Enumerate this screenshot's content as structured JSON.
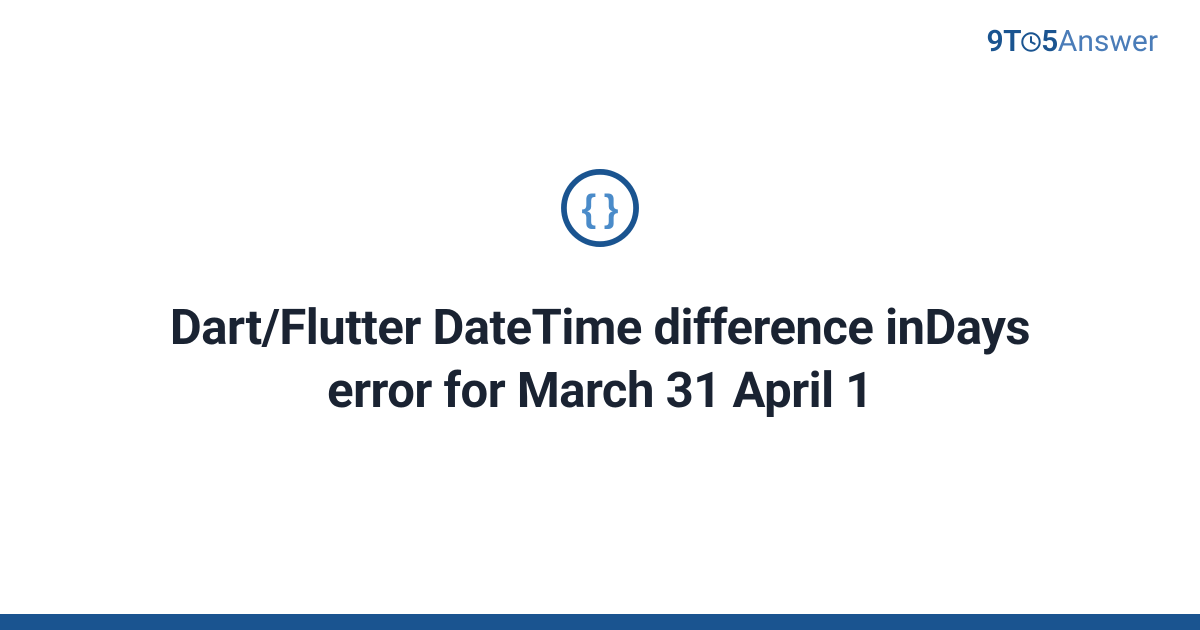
{
  "brand": {
    "logo_nine": "9",
    "logo_t": "T",
    "logo_five": "5",
    "logo_answer": "Answer"
  },
  "main": {
    "title": "Dart/Flutter DateTime difference inDays error for March 31 April 1"
  },
  "colors": {
    "brand_primary": "#1a5490",
    "brand_light": "#4a7cb8",
    "text_heading": "#1a2332"
  }
}
